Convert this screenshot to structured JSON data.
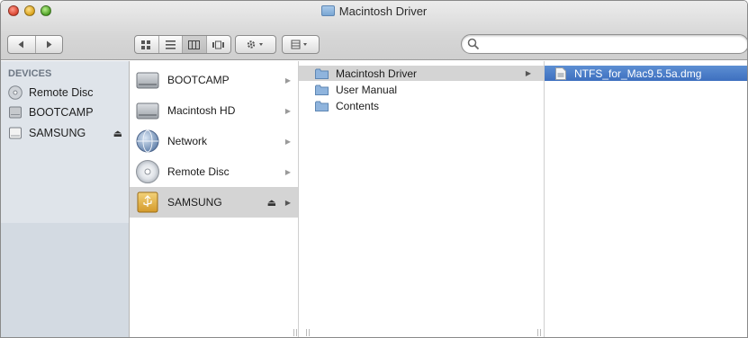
{
  "window": {
    "title": "Macintosh Driver"
  },
  "toolbar": {
    "back_icon": "back-arrow-icon",
    "forward_icon": "forward-arrow-icon",
    "views": [
      "icon-view-icon",
      "list-view-icon",
      "column-view-icon",
      "coverflow-view-icon"
    ],
    "active_view": "column",
    "action_menu_icon": "gear-icon",
    "arrange_menu_icon": "arrange-grid-icon",
    "search_placeholder": ""
  },
  "sidebar": {
    "section_title": "DEVICES",
    "items": [
      {
        "label": "Remote Disc",
        "icon": "disc-icon",
        "eject": ""
      },
      {
        "label": "BOOTCAMP",
        "icon": "hard-drive-icon",
        "eject": ""
      },
      {
        "label": "SAMSUNG",
        "icon": "external-drive-icon",
        "eject": "⏏"
      }
    ]
  },
  "column1": {
    "items": [
      {
        "label": "BOOTCAMP",
        "icon": "hard-drive-icon",
        "selected": false,
        "eject": ""
      },
      {
        "label": "Macintosh HD",
        "icon": "hard-drive-icon",
        "selected": false,
        "eject": ""
      },
      {
        "label": "Network",
        "icon": "network-globe-icon",
        "selected": false,
        "eject": ""
      },
      {
        "label": "Remote Disc",
        "icon": "disc-icon",
        "selected": false,
        "eject": ""
      },
      {
        "label": "SAMSUNG",
        "icon": "usb-drive-icon",
        "selected": true,
        "eject": "⏏"
      }
    ]
  },
  "column2": {
    "items": [
      {
        "label": "Macintosh Driver",
        "icon": "folder-icon",
        "selected": true
      },
      {
        "label": "User Manual",
        "icon": "folder-icon",
        "selected": false
      },
      {
        "label": "Contents",
        "icon": "folder-icon",
        "selected": false
      }
    ]
  },
  "column3": {
    "items": [
      {
        "label": "NTFS_for_Mac9.5.5a.dmg",
        "icon": "disk-image-icon",
        "selected": true
      }
    ]
  },
  "colors": {
    "selection_blue": "#3d6fbf",
    "selection_gray": "#d4d4d4",
    "sidebar_bg": "#dfe4ea",
    "folder_blue": "#7aa6d3"
  }
}
